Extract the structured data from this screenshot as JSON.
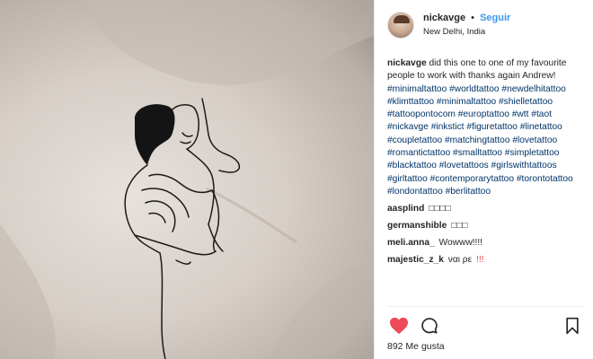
{
  "post": {
    "user": {
      "username": "nickavge",
      "separator": "•",
      "follow_label": "Seguir",
      "location": "New Delhi, India"
    },
    "caption": {
      "username": "nickavge",
      "text": "did this one to one of my favourite people to work with thanks again Andrew!",
      "hashtags": "#minimaltattoo #worldtattoo #newdelhitattoo #klimttattoo #minimaltattoo #shielletattoo #tattoopontocom #europtattoo #wtt #taot #nickavge #inkstict #figuretattoo #linetattoo #coupletattoo #matchingtattoo #lovetattoo #romantictattoo #smalltattoo #simpletattoo #blacktattoo #lovetattoos #girlswithtattoos #girltattoo #contemporarytattoo #torontotattoo #londontattoo #berlitattoo"
    },
    "comments": [
      {
        "username": "aasplind",
        "text": "□□□□"
      },
      {
        "username": "germanshible",
        "text": "□□□"
      },
      {
        "username": "meli.anna_",
        "text": "Wowww!!!!"
      },
      {
        "username": "majestic_z_k",
        "text": "ναι ρε",
        "emphasis": "!!!"
      }
    ],
    "actions": {
      "like_icon": "heart-icon",
      "comment_icon": "comment-icon",
      "save_icon": "bookmark-icon",
      "liked": true
    },
    "likes_text": "892 Me gusta"
  },
  "colors": {
    "link": "#003569",
    "follow": "#3897f0",
    "like": "#ed4956",
    "text": "#262626"
  }
}
